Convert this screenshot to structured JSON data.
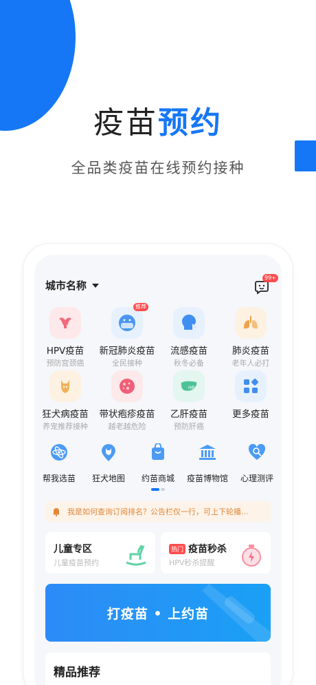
{
  "hero": {
    "title_main": "疫苗",
    "title_accent": "预约",
    "subtitle": "全品类疫苗在线预约接种"
  },
  "topbar": {
    "city": "城市名称",
    "msg_badge": "99+"
  },
  "vaccines": [
    {
      "name": "HPV疫苗",
      "desc": "预防宫颈癌",
      "icon": "uterus-icon",
      "bg": "#fde8ea",
      "color": "#f06b7d"
    },
    {
      "name": "新冠肺炎疫苗",
      "desc": "全民接种",
      "icon": "mask-face-icon",
      "bg": "#e6f1fd",
      "color": "#4a96f2",
      "tag": "推荐"
    },
    {
      "name": "流感疫苗",
      "desc": "秋冬必备",
      "icon": "sneeze-head-icon",
      "bg": "#e6f1fd",
      "color": "#3f8ef0"
    },
    {
      "name": "肺炎疫苗",
      "desc": "老年人必打",
      "icon": "lungs-icon",
      "bg": "#fdf1e2",
      "color": "#f0a34a"
    },
    {
      "name": "狂犬病疫苗",
      "desc": "养宠推荐接种",
      "icon": "dog-icon",
      "bg": "#fdf1e2",
      "color": "#eeb25a"
    },
    {
      "name": "带状疱疹疫苗",
      "desc": "越老越危险",
      "icon": "virus-icon",
      "bg": "#fde8ea",
      "color": "#f05f76"
    },
    {
      "name": "乙肝疫苗",
      "desc": "预防肝癌",
      "icon": "liver-icon",
      "bg": "#e3f6ef",
      "color": "#4cc397"
    },
    {
      "name": "更多疫苗",
      "desc": "",
      "icon": "grid-apps-icon",
      "bg": "#e6f1fd",
      "color": "#3f8ef0"
    }
  ],
  "tools": [
    {
      "label": "帮我选苗",
      "icon": "atom-icon"
    },
    {
      "label": "狂犬地图",
      "icon": "dog-map-pin-icon"
    },
    {
      "label": "约苗商城",
      "icon": "shopping-bag-icon"
    },
    {
      "label": "疫苗博物馆",
      "icon": "museum-icon"
    },
    {
      "label": "心理测评",
      "icon": "heart-search-icon"
    }
  ],
  "notice": {
    "text": "我是如何查询订阅排名？公告栏仅一行，可上下轮播..."
  },
  "cards": [
    {
      "title": "儿童专区",
      "desc": "儿童疫苗预约",
      "icon": "rocking-horse-icon"
    },
    {
      "badge": "热门",
      "title": "疫苗秒杀",
      "desc": "HPV秒杀提醒",
      "icon": "stopwatch-icon"
    }
  ],
  "banner": {
    "text": "打疫苗 • 上约苗"
  },
  "recommend": {
    "title": "精品推荐"
  },
  "colors": {
    "primary": "#1677f6",
    "notice_text": "#e0883a",
    "hot": "#ff4d4f"
  }
}
